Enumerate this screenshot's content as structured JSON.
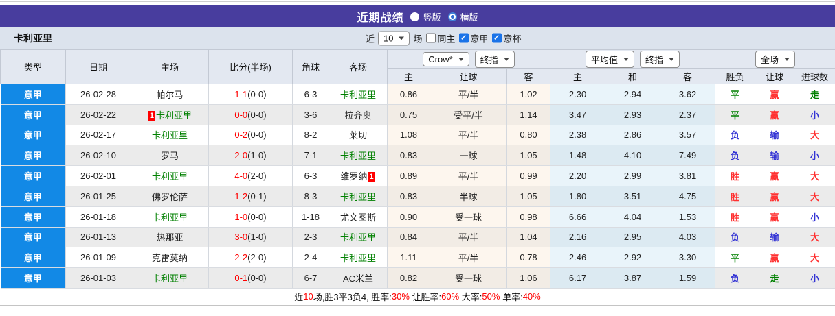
{
  "title_bar": {
    "title": "近期战绩",
    "radios": [
      {
        "label": "竖版",
        "checked": false
      },
      {
        "label": "横版",
        "checked": true
      }
    ]
  },
  "filter_bar": {
    "team": "卡利亚里",
    "prefix": "近",
    "games_selected": "10",
    "suffix": "场",
    "checkboxes": [
      {
        "label": "同主",
        "checked": false
      },
      {
        "label": "意甲",
        "checked": true
      },
      {
        "label": "意杯",
        "checked": true
      }
    ]
  },
  "table": {
    "main_columns": [
      "类型",
      "日期",
      "主场",
      "比分(半场)",
      "角球",
      "客场"
    ],
    "selects": {
      "crow": "Crow*",
      "crow_index": "终指",
      "avg": "平均值",
      "avg_index": "终指",
      "scope": "全场"
    },
    "sub_columns": [
      "主",
      "让球",
      "客",
      "主",
      "和",
      "客",
      "胜负",
      "让球",
      "进球数"
    ],
    "rows": [
      {
        "league": "意甲",
        "date": "26-02-28",
        "home": "帕尔马",
        "home_badge": "",
        "home_is_team": false,
        "score": "1-1",
        "half": "(0-0)",
        "corner": "6-3",
        "away": "卡利亚里",
        "away_badge": "",
        "away_is_team": true,
        "odds": [
          "0.86",
          "平/半",
          "1.02"
        ],
        "avg": [
          "2.30",
          "2.94",
          "3.62"
        ],
        "res": [
          [
            "平",
            "green"
          ],
          [
            "赢",
            "red"
          ],
          [
            "走",
            "green"
          ]
        ]
      },
      {
        "league": "意甲",
        "date": "26-02-22",
        "home": "卡利亚里",
        "home_badge": "1",
        "home_is_team": true,
        "score": "0-0",
        "half": "(0-0)",
        "corner": "3-6",
        "away": "拉齐奥",
        "away_badge": "",
        "away_is_team": false,
        "odds": [
          "0.75",
          "受平/半",
          "1.14"
        ],
        "avg": [
          "3.47",
          "2.93",
          "2.37"
        ],
        "res": [
          [
            "平",
            "green"
          ],
          [
            "赢",
            "red"
          ],
          [
            "小",
            "blue"
          ]
        ]
      },
      {
        "league": "意甲",
        "date": "26-02-17",
        "home": "卡利亚里",
        "home_badge": "",
        "home_is_team": true,
        "score": "0-2",
        "half": "(0-0)",
        "corner": "8-2",
        "away": "莱切",
        "away_badge": "",
        "away_is_team": false,
        "odds": [
          "1.08",
          "平/半",
          "0.80"
        ],
        "avg": [
          "2.38",
          "2.86",
          "3.57"
        ],
        "res": [
          [
            "负",
            "blue"
          ],
          [
            "输",
            "blue"
          ],
          [
            "大",
            "red"
          ]
        ]
      },
      {
        "league": "意甲",
        "date": "26-02-10",
        "home": "罗马",
        "home_badge": "",
        "home_is_team": false,
        "score": "2-0",
        "half": "(1-0)",
        "corner": "7-1",
        "away": "卡利亚里",
        "away_badge": "",
        "away_is_team": true,
        "odds": [
          "0.83",
          "一球",
          "1.05"
        ],
        "avg": [
          "1.48",
          "4.10",
          "7.49"
        ],
        "res": [
          [
            "负",
            "blue"
          ],
          [
            "输",
            "blue"
          ],
          [
            "小",
            "blue"
          ]
        ]
      },
      {
        "league": "意甲",
        "date": "26-02-01",
        "home": "卡利亚里",
        "home_badge": "",
        "home_is_team": true,
        "score": "4-0",
        "half": "(2-0)",
        "corner": "6-3",
        "away": "维罗纳",
        "away_badge": "1",
        "away_is_team": false,
        "odds": [
          "0.89",
          "平/半",
          "0.99"
        ],
        "avg": [
          "2.20",
          "2.99",
          "3.81"
        ],
        "res": [
          [
            "胜",
            "red"
          ],
          [
            "赢",
            "red"
          ],
          [
            "大",
            "red"
          ]
        ]
      },
      {
        "league": "意甲",
        "date": "26-01-25",
        "home": "佛罗伦萨",
        "home_badge": "",
        "home_is_team": false,
        "score": "1-2",
        "half": "(0-1)",
        "corner": "8-3",
        "away": "卡利亚里",
        "away_badge": "",
        "away_is_team": true,
        "odds": [
          "0.83",
          "半球",
          "1.05"
        ],
        "avg": [
          "1.80",
          "3.51",
          "4.75"
        ],
        "res": [
          [
            "胜",
            "red"
          ],
          [
            "赢",
            "red"
          ],
          [
            "大",
            "red"
          ]
        ]
      },
      {
        "league": "意甲",
        "date": "26-01-18",
        "home": "卡利亚里",
        "home_badge": "",
        "home_is_team": true,
        "score": "1-0",
        "half": "(0-0)",
        "corner": "1-18",
        "away": "尤文图斯",
        "away_badge": "",
        "away_is_team": false,
        "odds": [
          "0.90",
          "受一球",
          "0.98"
        ],
        "avg": [
          "6.66",
          "4.04",
          "1.53"
        ],
        "res": [
          [
            "胜",
            "red"
          ],
          [
            "赢",
            "red"
          ],
          [
            "小",
            "blue"
          ]
        ]
      },
      {
        "league": "意甲",
        "date": "26-01-13",
        "home": "热那亚",
        "home_badge": "",
        "home_is_team": false,
        "score": "3-0",
        "half": "(1-0)",
        "corner": "2-3",
        "away": "卡利亚里",
        "away_badge": "",
        "away_is_team": true,
        "odds": [
          "0.84",
          "平/半",
          "1.04"
        ],
        "avg": [
          "2.16",
          "2.95",
          "4.03"
        ],
        "res": [
          [
            "负",
            "blue"
          ],
          [
            "输",
            "blue"
          ],
          [
            "大",
            "red"
          ]
        ]
      },
      {
        "league": "意甲",
        "date": "26-01-09",
        "home": "克雷莫纳",
        "home_badge": "",
        "home_is_team": false,
        "score": "2-2",
        "half": "(2-0)",
        "corner": "2-4",
        "away": "卡利亚里",
        "away_badge": "",
        "away_is_team": true,
        "odds": [
          "1.11",
          "平/半",
          "0.78"
        ],
        "avg": [
          "2.46",
          "2.92",
          "3.30"
        ],
        "res": [
          [
            "平",
            "green"
          ],
          [
            "赢",
            "red"
          ],
          [
            "大",
            "red"
          ]
        ]
      },
      {
        "league": "意甲",
        "date": "26-01-03",
        "home": "卡利亚里",
        "home_badge": "",
        "home_is_team": true,
        "score": "0-1",
        "half": "(0-0)",
        "corner": "6-7",
        "away": "AC米兰",
        "away_badge": "",
        "away_is_team": false,
        "odds": [
          "0.82",
          "受一球",
          "1.06"
        ],
        "avg": [
          "6.17",
          "3.87",
          "1.59"
        ],
        "res": [
          [
            "负",
            "blue"
          ],
          [
            "走",
            "green"
          ],
          [
            "小",
            "blue"
          ]
        ]
      }
    ]
  },
  "summary": {
    "parts": [
      {
        "text": "近"
      },
      {
        "text": "10",
        "red": true
      },
      {
        "text": "场,胜3平3负4, 胜率:"
      },
      {
        "text": "30%",
        "red": true
      },
      {
        "text": " 让胜率:"
      },
      {
        "text": "60%",
        "red": true
      },
      {
        "text": " 大率:"
      },
      {
        "text": "50%",
        "red": true
      },
      {
        "text": " 单率:"
      },
      {
        "text": "40%",
        "red": true
      }
    ]
  },
  "colors": {
    "accent_purple": "#483d9e",
    "league_blue": "#1289e6",
    "team_green": "#008000",
    "score_red": "#ff0000",
    "result_red": "#ff3030",
    "result_blue": "#3232d4",
    "result_green": "#008000"
  }
}
